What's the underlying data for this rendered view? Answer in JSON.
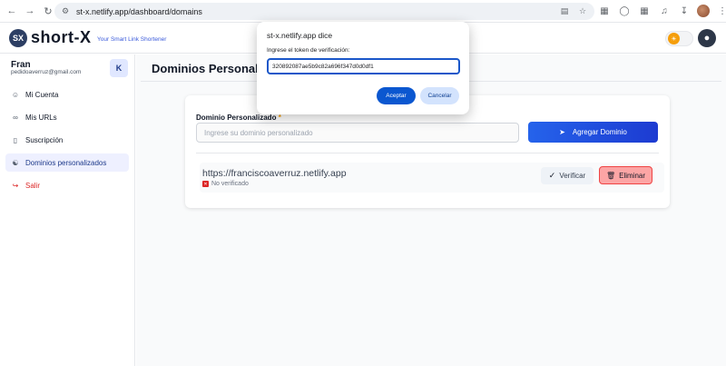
{
  "browser": {
    "url": "st-x.netlify.app/dashboard/domains",
    "icons": [
      "back-icon",
      "forward-icon",
      "reload-icon",
      "site-settings-icon",
      "translate-icon",
      "bookmark-star-icon",
      "extension-icon",
      "extensions-puzzle-icon",
      "media-icon",
      "download-icon",
      "profile-avatar"
    ]
  },
  "header": {
    "logo_mark": "SX",
    "logo_text": "short-X",
    "tagline": "Your Smart Link Shortener"
  },
  "sidebar": {
    "user_name": "Fran",
    "user_email": "pedidoaverruz@gmail.com",
    "collapse_glyph": "K",
    "items": [
      {
        "label": "Mi Cuenta",
        "icon": "user-icon"
      },
      {
        "label": "Mis URLs",
        "icon": "link-icon"
      },
      {
        "label": "Suscripción",
        "icon": "bookmark-icon"
      },
      {
        "label": "Dominios personalizados",
        "icon": "globe-icon",
        "active": true
      },
      {
        "label": "Salir",
        "icon": "logout-icon"
      }
    ]
  },
  "main": {
    "title": "Dominios Personaliz",
    "field_label": "Dominio Personalizado",
    "required_mark": "*",
    "input_placeholder": "Ingrese su dominio personalizado",
    "add_button": "Agregar Dominio",
    "domains": [
      {
        "url": "https://franciscoaverruz.netlify.app",
        "status": "No verificado",
        "verify_label": "Verificar",
        "delete_label": "Eliminar"
      }
    ]
  },
  "dialog": {
    "title": "st-x.netlify.app dice",
    "message": "Ingrese el token de verificación:",
    "token": "320892087ae5b9c82a696f347d0d0df1",
    "ok_label": "Aceptar",
    "cancel_label": "Cancelar"
  },
  "colors": {
    "primary": "#2563eb",
    "active_bg": "#eef0ff",
    "danger": "#dc2626",
    "danger_bg": "#fca5a5",
    "dialog_primary": "#0b57d0"
  }
}
